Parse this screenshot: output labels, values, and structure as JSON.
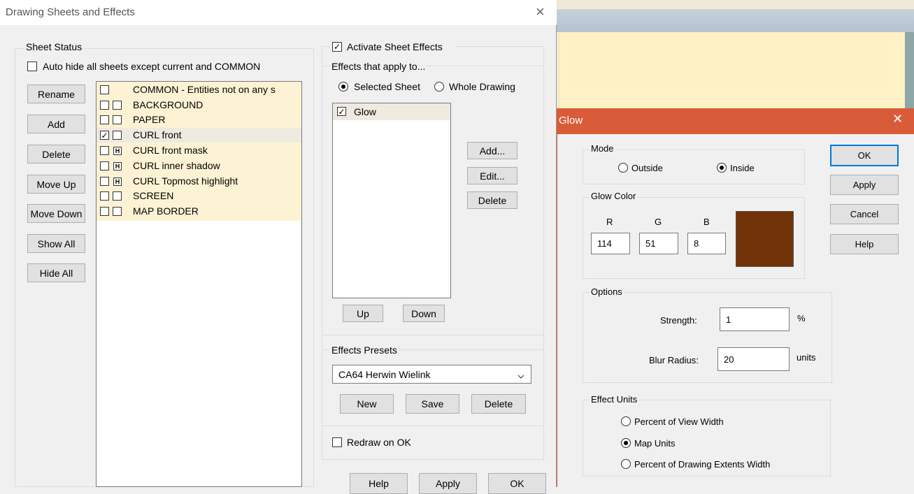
{
  "main_dialog": {
    "title": "Drawing Sheets and Effects",
    "close_glyph": "×",
    "sheet_status": {
      "legend": "Sheet Status",
      "auto_hide_label": "Auto hide all sheets except current and COMMON",
      "buttons": [
        "Rename",
        "Add",
        "Delete",
        "Move Up",
        "Move Down",
        "Show All",
        "Hide All"
      ],
      "sheets": [
        {
          "name": "COMMON - Entities not on any s",
          "checked": false,
          "hidden": null
        },
        {
          "name": "BACKGROUND",
          "checked": false,
          "hidden": false
        },
        {
          "name": "PAPER",
          "checked": false,
          "hidden": false
        },
        {
          "name": "CURL front",
          "checked": true,
          "hidden": false
        },
        {
          "name": "CURL front mask",
          "checked": false,
          "hidden": true
        },
        {
          "name": "CURL inner shadow",
          "checked": false,
          "hidden": true
        },
        {
          "name": "CURL Topmost highlight",
          "checked": false,
          "hidden": true
        },
        {
          "name": "SCREEN",
          "checked": false,
          "hidden": false
        },
        {
          "name": "MAP BORDER",
          "checked": false,
          "hidden": false
        }
      ],
      "hidden_marker": "H"
    },
    "effects": {
      "activate_label": "Activate Sheet Effects",
      "activate_checked": true,
      "apply_to_label": "Effects that apply to...",
      "selected_sheet_label": "Selected Sheet",
      "whole_drawing_label": "Whole Drawing",
      "selected_option": "selected_sheet",
      "list": [
        {
          "name": "Glow",
          "checked": true
        }
      ],
      "add_label": "Add...",
      "edit_label": "Edit...",
      "delete_label": "Delete",
      "up_label": "Up",
      "down_label": "Down"
    },
    "presets": {
      "legend": "Effects Presets",
      "selected": "CA64 Herwin Wielink",
      "new_label": "New",
      "save_label": "Save",
      "delete_label": "Delete"
    },
    "redraw_label": "Redraw on OK",
    "footer": {
      "help": "Help",
      "apply": "Apply",
      "ok": "OK"
    }
  },
  "glow_dialog": {
    "title": "Glow",
    "close_glyph": "✕",
    "mode": {
      "legend": "Mode",
      "outside_label": "Outside",
      "inside_label": "Inside",
      "selected": "inside"
    },
    "color": {
      "legend": "Glow Color",
      "r_label": "R",
      "g_label": "G",
      "b_label": "B",
      "r": "114",
      "g": "51",
      "b": "8",
      "swatch": "#723308"
    },
    "options": {
      "legend": "Options",
      "strength_label": "Strength:",
      "strength_value": "1",
      "strength_unit": "%",
      "blur_label": "Blur Radius:",
      "blur_value": "20",
      "blur_unit": "units"
    },
    "units": {
      "legend": "Effect Units",
      "view_width_label": "Percent of View Width",
      "map_units_label": "Map Units",
      "extents_label": "Percent of Drawing Extents Width",
      "selected": "map_units"
    },
    "buttons": {
      "ok": "OK",
      "apply": "Apply",
      "cancel": "Cancel",
      "help": "Help"
    }
  },
  "colors": {
    "glow_titlebar": "#d95c3a",
    "sheet_row_tint": "#fdf3d4",
    "selected_row": "#eeeadf",
    "background_canvas": "#fdf1c5",
    "accent_blue": "#0078d7"
  }
}
